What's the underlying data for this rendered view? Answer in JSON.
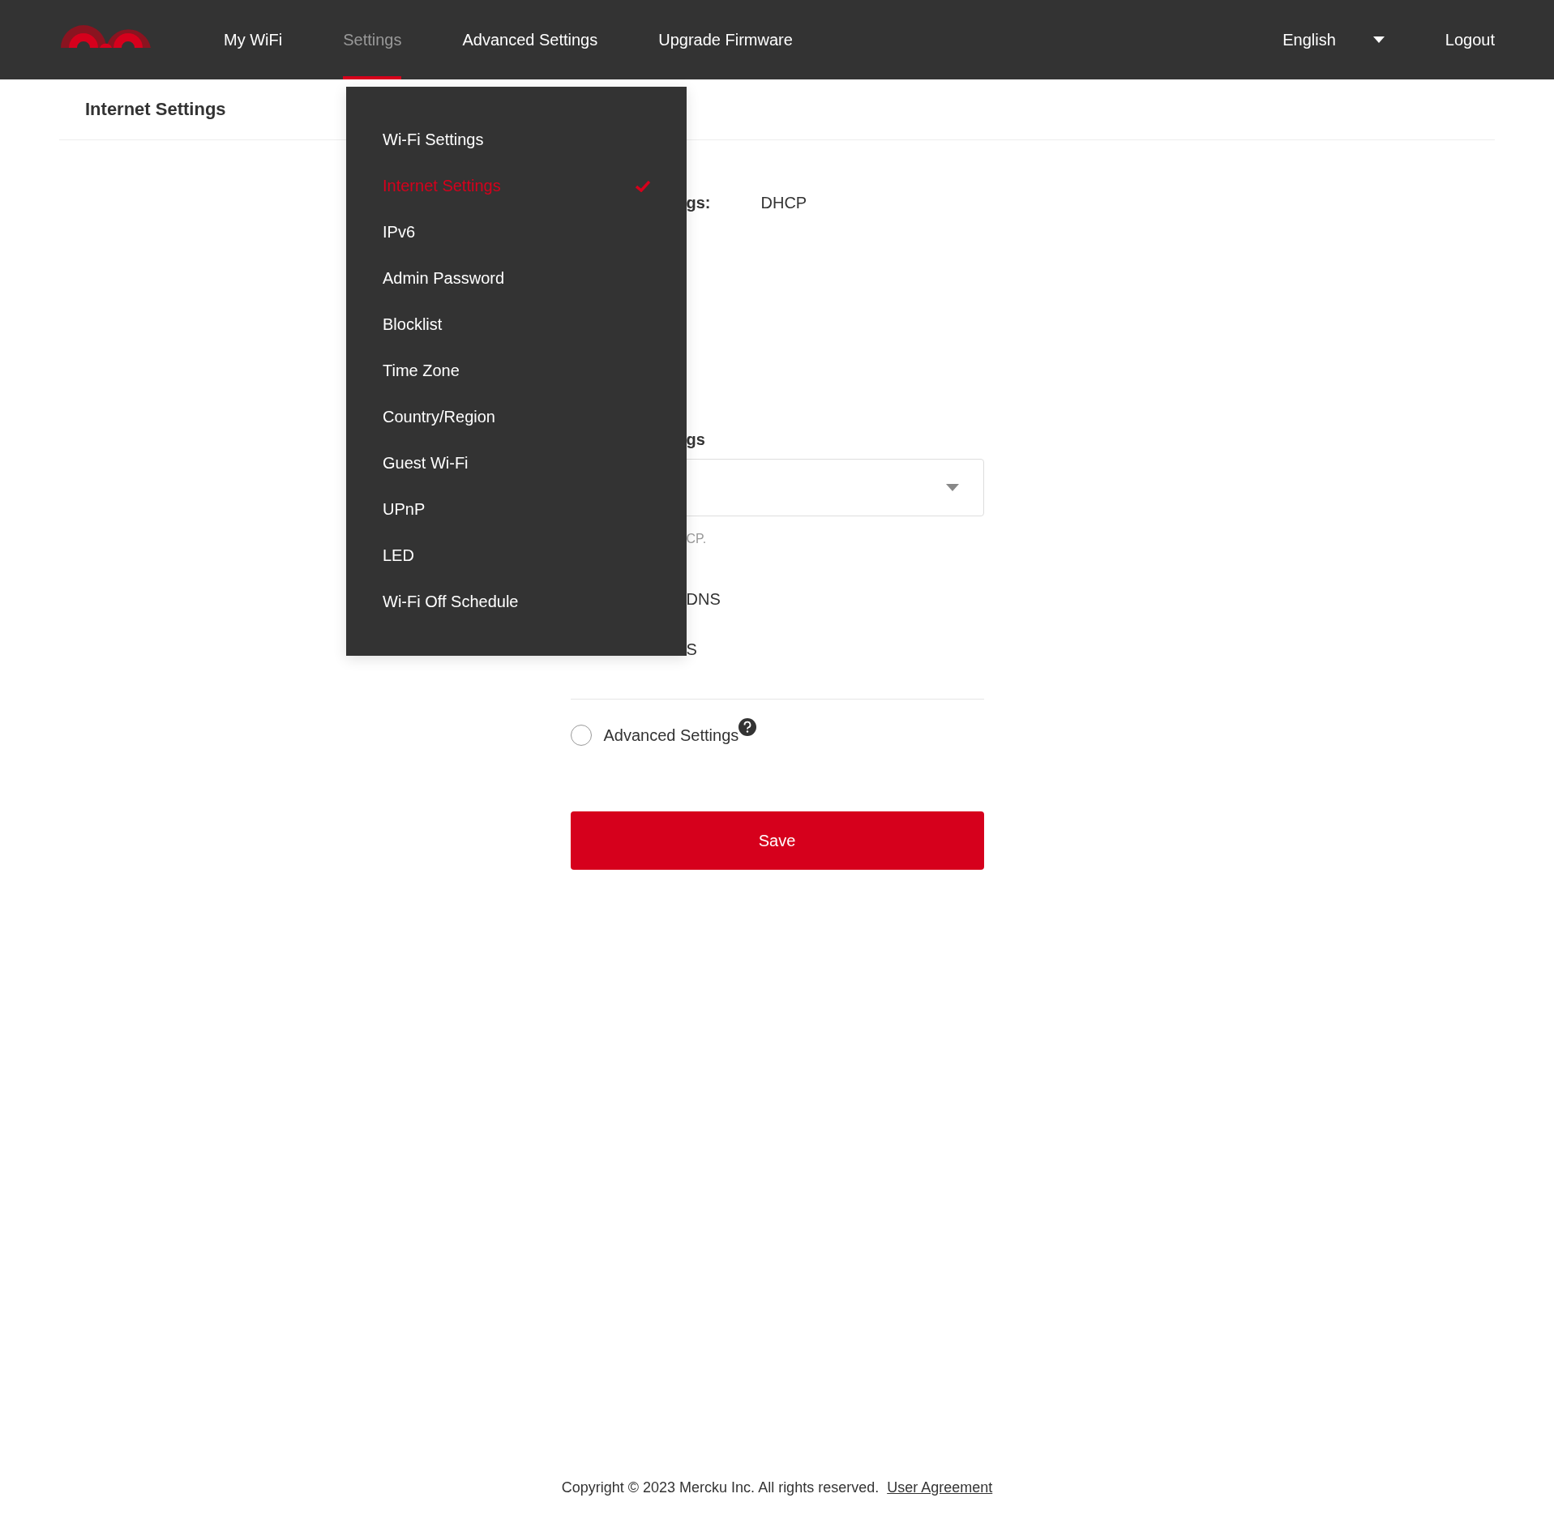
{
  "header": {
    "nav": [
      {
        "label": "My WiFi",
        "selected": false
      },
      {
        "label": "Settings",
        "selected": true
      },
      {
        "label": "Advanced Settings",
        "selected": false
      },
      {
        "label": "Upgrade Firmware",
        "selected": false
      }
    ],
    "language": "English",
    "logout": "Logout"
  },
  "page_title": "Internet Settings",
  "settings_menu": {
    "items": [
      {
        "label": "Wi-Fi Settings",
        "selected": false
      },
      {
        "label": "Internet Settings",
        "selected": true
      },
      {
        "label": "IPv6",
        "selected": false
      },
      {
        "label": "Admin Password",
        "selected": false
      },
      {
        "label": "Blocklist",
        "selected": false
      },
      {
        "label": "Time Zone",
        "selected": false
      },
      {
        "label": "Country/Region",
        "selected": false
      },
      {
        "label": "Guest Wi-Fi",
        "selected": false
      },
      {
        "label": "UPnP",
        "selected": false
      },
      {
        "label": "LED",
        "selected": false
      },
      {
        "label": "Wi-Fi Off Schedule",
        "selected": false
      }
    ]
  },
  "form": {
    "connection_label": "gs:",
    "connection_value": "DHCP",
    "section_label": "gs",
    "hint": "CP.",
    "options": [
      {
        "label": "DNS"
      },
      {
        "label": "S"
      }
    ],
    "advanced": {
      "label": "Advanced Settings",
      "checked": false
    },
    "save": "Save"
  },
  "footer": {
    "copyright": "Copyright © 2023 Mercku Inc. All rights reserved.",
    "link": "User Agreement"
  }
}
